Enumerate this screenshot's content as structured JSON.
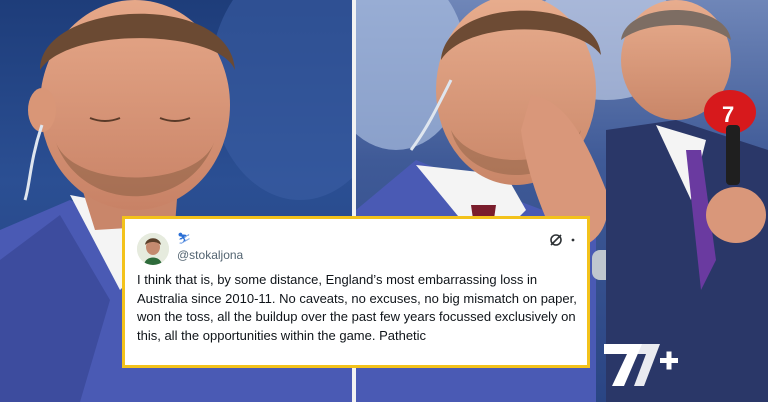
{
  "tweet": {
    "badge": "⛷",
    "handle": "@stokaljona",
    "body": "I think that is, by some distance, England’s most embarrassing loss in Australia since 2010-11. No caveats, no excuses, no big mismatch on paper, won the toss, all the buildup over the past few years focussed exclusively on this, all the opportunities within the game. Pathetic"
  },
  "logo": {
    "text": "7+"
  },
  "colors": {
    "card_border": "#f3c21b",
    "logo_fill": "#ffffff",
    "mic_red": "#d7191c",
    "suit_blue": "#4a5ab4"
  },
  "icons": [
    "grok-icon",
    "more-icon",
    "verified-badge-icon"
  ]
}
